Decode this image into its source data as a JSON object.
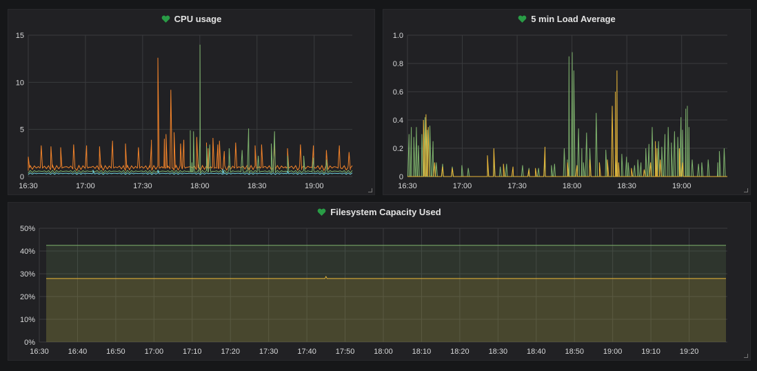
{
  "panels": {
    "cpu": {
      "title": "CPU usage",
      "status_icon": "heart-icon",
      "chart_data": {
        "type": "line",
        "x": [
          "16:30",
          "17:00",
          "17:30",
          "18:00",
          "18:30",
          "19:00"
        ],
        "x_range": [
          "16:30",
          "19:20"
        ],
        "ylim": [
          0,
          15
        ],
        "y_ticks": [
          "0",
          "5",
          "10",
          "15"
        ],
        "grid": true,
        "series": [
          {
            "color": "#f2832a",
            "baseline": 0.9,
            "peaks": [
              [
                0.0,
                2.1
              ],
              [
                0.04,
                3.3
              ],
              [
                0.07,
                3.2
              ],
              [
                0.1,
                3.1
              ],
              [
                0.14,
                3.4
              ],
              [
                0.18,
                3.3
              ],
              [
                0.22,
                3.2
              ],
              [
                0.26,
                3.7
              ],
              [
                0.3,
                3.5
              ],
              [
                0.34,
                3.1
              ],
              [
                0.38,
                3.5
              ],
              [
                0.42,
                4.0
              ],
              [
                0.47,
                3.5
              ],
              [
                0.52,
                4.2
              ],
              [
                0.55,
                3.6
              ],
              [
                0.57,
                4.1
              ],
              [
                0.59,
                3.8
              ],
              [
                0.64,
                3.6
              ],
              [
                0.7,
                3.3
              ],
              [
                0.72,
                3.4
              ],
              [
                0.76,
                3.7
              ],
              [
                0.8,
                3.0
              ],
              [
                0.84,
                3.4
              ],
              [
                0.88,
                3.3
              ],
              [
                0.92,
                2.8
              ],
              [
                0.96,
                3.3
              ],
              [
                0.99,
                2.6
              ],
              [
                0.26,
                3.8
              ],
              [
                0.38,
                3.9
              ],
              [
                0.45,
                4.7
              ],
              [
                0.48,
                3.9
              ],
              [
                0.555,
                3.0
              ],
              [
                0.585,
                3.4
              ],
              [
                0.605,
                2.7
              ],
              [
                0.4,
                12.6
              ],
              [
                0.425,
                4.5
              ],
              [
                0.44,
                9.2
              ]
            ]
          },
          {
            "color": "#7eb26d",
            "baseline": 0.5,
            "peaks": [
              [
                0.5,
                4.9
              ],
              [
                0.51,
                4.8
              ],
              [
                0.53,
                4.3
              ],
              [
                0.55,
                3.2
              ],
              [
                0.505,
                1.5
              ],
              [
                0.53,
                14.0
              ],
              [
                0.56,
                3.4
              ],
              [
                0.62,
                3.0
              ],
              [
                0.66,
                2.8
              ],
              [
                0.68,
                5.1
              ],
              [
                0.71,
                2.2
              ],
              [
                0.75,
                3.5
              ],
              [
                0.76,
                4.8
              ],
              [
                0.8,
                2.2
              ],
              [
                0.85,
                2.2
              ],
              [
                0.88,
                2.0
              ],
              [
                0.92,
                1.8
              ]
            ]
          },
          {
            "color": "#6ed0e0",
            "baseline": 0.3,
            "peaks": [
              [
                0.2,
                0.7
              ],
              [
                0.4,
                0.7
              ],
              [
                0.6,
                0.8
              ],
              [
                0.8,
                0.6
              ]
            ]
          }
        ]
      }
    },
    "load": {
      "title": "5 min Load Average",
      "status_icon": "heart-icon",
      "chart_data": {
        "type": "line",
        "x": [
          "16:30",
          "17:00",
          "17:30",
          "18:00",
          "18:30",
          "19:00"
        ],
        "x_range": [
          "16:30",
          "19:25"
        ],
        "ylim": [
          0,
          1.0
        ],
        "y_ticks": [
          "0",
          "0.2",
          "0.4",
          "0.6",
          "0.8",
          "1.0"
        ],
        "grid": true,
        "series": [
          {
            "color": "#7eb26d",
            "peaks": [
              [
                0.005,
                0.3
              ],
              [
                0.012,
                0.35
              ],
              [
                0.02,
                0.28
              ],
              [
                0.028,
                0.35
              ],
              [
                0.034,
                0.22
              ],
              [
                0.045,
                0.3
              ],
              [
                0.055,
                0.42
              ],
              [
                0.062,
                0.33
              ],
              [
                0.07,
                0.36
              ],
              [
                0.08,
                0.25
              ],
              [
                0.09,
                0.1
              ],
              [
                0.11,
                0.09
              ],
              [
                0.14,
                0.07
              ],
              [
                0.17,
                0.08
              ],
              [
                0.19,
                0.06
              ],
              [
                0.25,
                0.1
              ],
              [
                0.27,
                0.12
              ],
              [
                0.29,
                0.07
              ],
              [
                0.31,
                0.09
              ],
              [
                0.36,
                0.08
              ],
              [
                0.38,
                0.06
              ],
              [
                0.41,
                0.06
              ],
              [
                0.43,
                0.12
              ],
              [
                0.45,
                0.08
              ],
              [
                0.46,
                0.09
              ],
              [
                0.49,
                0.2
              ],
              [
                0.5,
                0.12
              ],
              [
                0.505,
                0.85
              ],
              [
                0.515,
                0.88
              ],
              [
                0.52,
                0.75
              ],
              [
                0.535,
                0.34
              ],
              [
                0.545,
                0.2
              ],
              [
                0.55,
                0.1
              ],
              [
                0.56,
                0.31
              ],
              [
                0.57,
                0.2
              ],
              [
                0.59,
                0.45
              ],
              [
                0.62,
                0.19
              ],
              [
                0.65,
                0.15
              ],
              [
                0.67,
                0.16
              ],
              [
                0.685,
                0.14
              ],
              [
                0.69,
                0.1
              ],
              [
                0.71,
                0.08
              ],
              [
                0.72,
                0.12
              ],
              [
                0.73,
                0.1
              ],
              [
                0.745,
                0.2
              ],
              [
                0.755,
                0.23
              ],
              [
                0.765,
                0.35
              ],
              [
                0.775,
                0.22
              ],
              [
                0.785,
                0.25
              ],
              [
                0.795,
                0.21
              ],
              [
                0.805,
                0.3
              ],
              [
                0.815,
                0.35
              ],
              [
                0.825,
                0.24
              ],
              [
                0.835,
                0.32
              ],
              [
                0.845,
                0.28
              ],
              [
                0.855,
                0.42
              ],
              [
                0.86,
                0.33
              ],
              [
                0.87,
                0.48
              ],
              [
                0.875,
                0.5
              ],
              [
                0.88,
                0.35
              ],
              [
                0.89,
                0.12
              ],
              [
                0.91,
                0.09
              ],
              [
                0.92,
                0.1
              ],
              [
                0.94,
                0.12
              ],
              [
                0.97,
                0.1
              ],
              [
                0.975,
                0.18
              ],
              [
                0.99,
                0.2
              ]
            ]
          },
          {
            "color": "#eab839",
            "peaks": [
              [
                0.05,
                0.4
              ],
              [
                0.058,
                0.44
              ],
              [
                0.065,
                0.35
              ],
              [
                0.085,
                0.1
              ],
              [
                0.11,
                0.07
              ],
              [
                0.14,
                0.06
              ],
              [
                0.25,
                0.15
              ],
              [
                0.27,
                0.2
              ],
              [
                0.3,
                0.09
              ],
              [
                0.33,
                0.07
              ],
              [
                0.38,
                0.05
              ],
              [
                0.4,
                0.06
              ],
              [
                0.43,
                0.21
              ],
              [
                0.5,
                0.1
              ],
              [
                0.53,
                0.08
              ],
              [
                0.57,
                0.12
              ],
              [
                0.6,
                0.1
              ],
              [
                0.625,
                0.12
              ],
              [
                0.64,
                0.5
              ],
              [
                0.65,
                0.6
              ],
              [
                0.655,
                0.75
              ],
              [
                0.66,
                0.1
              ],
              [
                0.7,
                0.06
              ],
              [
                0.74,
                0.05
              ],
              [
                0.76,
                0.1
              ],
              [
                0.775,
                0.25
              ],
              [
                0.78,
                0.2
              ],
              [
                0.79,
                0.12
              ],
              [
                0.85,
                0.2
              ],
              [
                0.86,
                0.1
              ]
            ]
          }
        ]
      }
    },
    "fs": {
      "title": "Filesystem Capacity Used",
      "status_icon": "heart-icon",
      "chart_data": {
        "type": "area",
        "x": [
          "16:30",
          "16:40",
          "16:50",
          "17:00",
          "17:10",
          "17:20",
          "17:30",
          "17:40",
          "17:50",
          "18:00",
          "18:10",
          "18:20",
          "18:30",
          "18:40",
          "18:50",
          "19:00",
          "19:10",
          "19:20"
        ],
        "x_range": [
          "16:30",
          "19:30"
        ],
        "ylim": [
          0,
          50
        ],
        "y_ticks": [
          "0%",
          "10%",
          "20%",
          "30%",
          "40%",
          "50%"
        ],
        "grid": true,
        "series": [
          {
            "name": "",
            "color": "#7eb26d",
            "value": 42.5
          },
          {
            "name": "",
            "color": "#eab839",
            "value": 27.9,
            "blip_at": "17:45",
            "blip_value": 28.8
          }
        ]
      }
    }
  }
}
